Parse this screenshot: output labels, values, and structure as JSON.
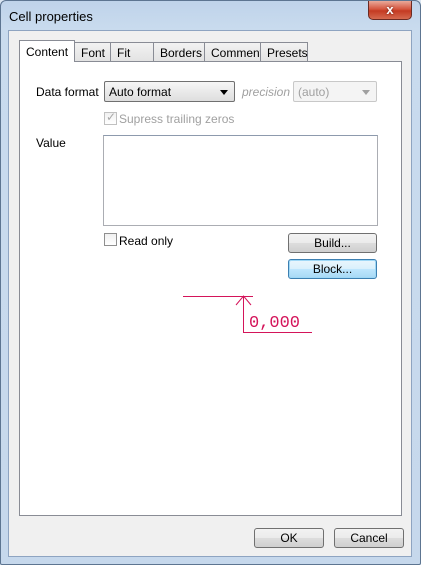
{
  "window": {
    "title": "Cell properties",
    "close_glyph": "x"
  },
  "tabs": [
    {
      "label": "Content",
      "active": true
    },
    {
      "label": "Font",
      "active": false
    },
    {
      "label": "Fit",
      "active": false
    },
    {
      "label": "Borders",
      "active": false
    },
    {
      "label": "Comment",
      "active": false
    },
    {
      "label": "Presets",
      "active": false
    }
  ],
  "content": {
    "data_format_label": "Data format",
    "data_format_value": "Auto format",
    "precision_label": "precision",
    "precision_value": "(auto)",
    "supress_label": "Supress trailing zeros",
    "supress_checked": true,
    "supress_enabled": false,
    "value_label": "Value",
    "value_text": "",
    "read_only_label": "Read only",
    "read_only_checked": false,
    "build_label": "Build...",
    "block_label": "Block...",
    "preview_text": "0,000",
    "preview_color": "#d4145a"
  },
  "footer": {
    "ok_label": "OK",
    "cancel_label": "Cancel"
  }
}
